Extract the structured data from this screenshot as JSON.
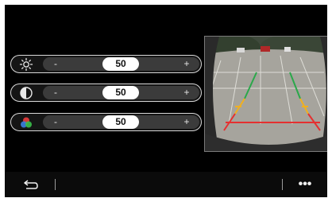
{
  "sliders": [
    {
      "id": "brightness",
      "icon": "sun-icon",
      "minus": "-",
      "plus": "+",
      "value": "50"
    },
    {
      "id": "contrast",
      "icon": "contrast-icon",
      "minus": "-",
      "plus": "+",
      "value": "50"
    },
    {
      "id": "color",
      "icon": "color-saturation-icon",
      "minus": "-",
      "plus": "+",
      "value": "50"
    }
  ],
  "camera": {
    "icon": "rear-camera-view"
  },
  "bottom_bar": {
    "back_icon": "back-arrow-icon",
    "more_label": "•••"
  },
  "colors": {
    "guide_near": "#e53030",
    "guide_mid": "#f0b020",
    "guide_far": "#2aa84a"
  }
}
